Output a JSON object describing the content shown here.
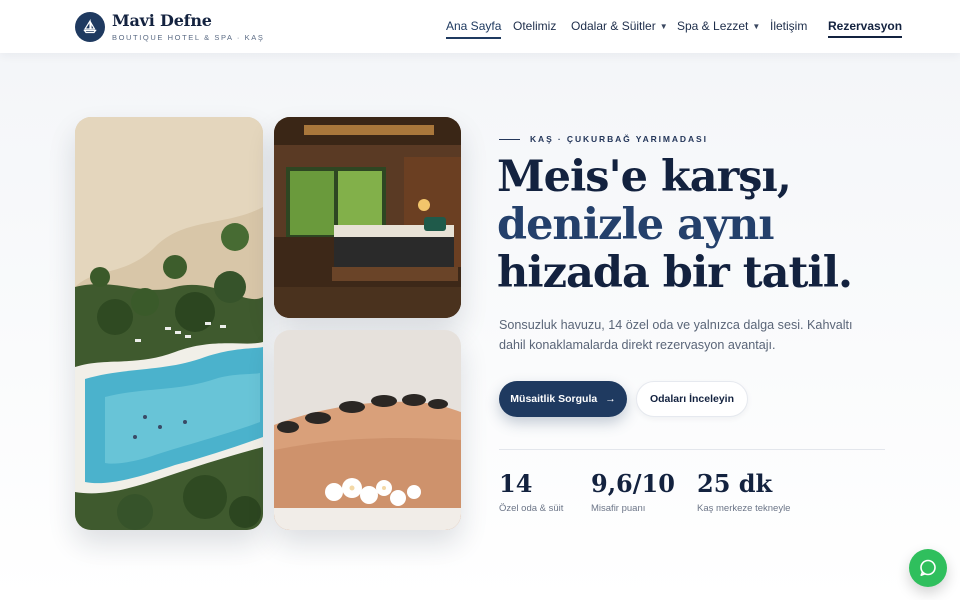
{
  "brand": {
    "name": "Mavi Defne",
    "tagline": "BOUTIQUE HOTEL & SPA · KAŞ",
    "logo_icon": "sailboat-icon"
  },
  "nav": {
    "items": [
      {
        "label": "Ana Sayfa",
        "active": true
      },
      {
        "label": "Otelimiz"
      },
      {
        "label": "Odalar & Süitler",
        "dropdown": true
      },
      {
        "label": "Spa & Lezzet",
        "dropdown": true
      },
      {
        "label": "İletişim"
      }
    ],
    "reserve_label": "Rezervasyon"
  },
  "hero": {
    "eyebrow": "KAŞ · ÇUKURBAĞ YARIMADASI",
    "headline": [
      "Meis'e karşı,",
      "denizle aynı",
      "hizada bir tatil."
    ],
    "lead": "Sonsuzluk havuzu, 14 özel oda ve yalnızca dalga sesi. Kahvaltı dahil konaklamalarda direkt rezervasyon avantajı.",
    "primary_cta": "Müsaitlik Sorgula",
    "secondary_cta": "Odaları İnceleyin"
  },
  "stats": [
    {
      "value": "14",
      "label": "Özel oda & süit"
    },
    {
      "value": "9,6/10",
      "label": "Misafir puanı"
    },
    {
      "value": "25 dk",
      "label": "Kaş merkeze tekneyle"
    }
  ],
  "colors": {
    "navy": "#1f3a60",
    "ink": "#13223f",
    "whatsapp_green": "#2fbf5d"
  }
}
